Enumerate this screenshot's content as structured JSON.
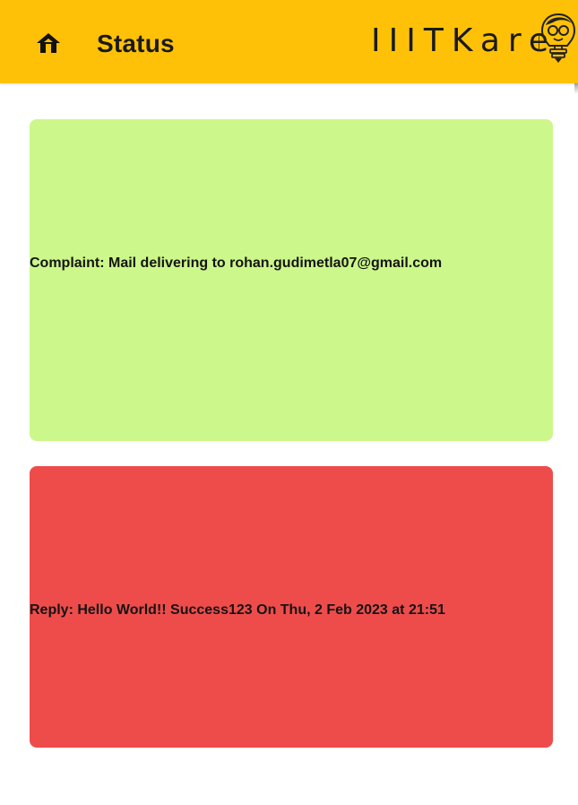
{
  "app_bar": {
    "title": "Status",
    "brand": "IIITKare",
    "background_color": "#FFC107",
    "home_icon": "home-icon",
    "logo_icon": "lightbulb-person-logo"
  },
  "cards": {
    "complaint": {
      "text": "Complaint: Mail delivering to rohan.gudimetla07@gmail.com",
      "background_color": "#CCF78A"
    },
    "reply": {
      "text": "Reply: Hello World!! Success123 On Thu, 2 Feb 2023 at 21:51",
      "background_color": "#EE4C4B"
    }
  }
}
